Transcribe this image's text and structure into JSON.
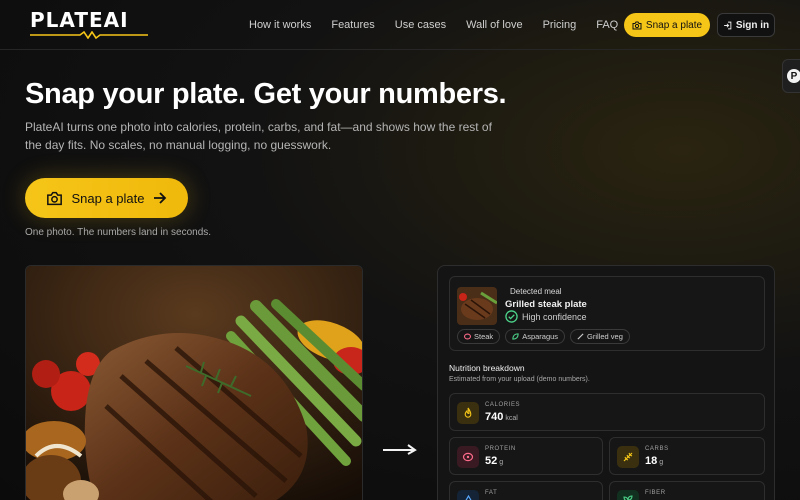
{
  "brand": {
    "name": "PLATEAI",
    "accent": "#f5c518"
  },
  "nav": {
    "links": [
      "How it works",
      "Features",
      "Use cases",
      "Wall of love",
      "Pricing",
      "FAQ"
    ],
    "cta_label": "Snap a plate",
    "signin_label": "Sign in"
  },
  "side_tab": {
    "letter": "P"
  },
  "hero": {
    "title": "Snap your plate. Get your numbers.",
    "subtitle": "PlateAI turns one photo into calories, protein, carbs, and fat—and shows how the rest of the day fits. No scales, no manual logging, no guesswork.",
    "cta_label": "Snap a plate",
    "note": "One photo. The numbers land in seconds."
  },
  "result": {
    "detected_label": "Detected meal",
    "meal_name": "Grilled steak plate",
    "confidence": "High confidence",
    "chips": [
      {
        "label": "Steak",
        "icon": "steak-icon"
      },
      {
        "label": "Asparagus",
        "icon": "leaf-icon"
      },
      {
        "label": "Grilled veg",
        "icon": "pepper-icon"
      }
    ],
    "breakdown_title": "Nutrition breakdown",
    "breakdown_sub": "Estimated from your upload (demo numbers).",
    "stats": {
      "calories": {
        "label": "CALORIES",
        "value": "740",
        "unit": "kcal",
        "icon": "flame-icon",
        "color": "#f5c518"
      },
      "protein": {
        "label": "PROTEIN",
        "value": "52",
        "unit": "g",
        "icon": "meat-icon",
        "color": "#ff6b8a"
      },
      "carbs": {
        "label": "CARBS",
        "value": "18",
        "unit": "g",
        "icon": "wheat-icon",
        "color": "#f5c518"
      },
      "fat": {
        "label": "FAT",
        "value": "",
        "unit": "",
        "icon": "droplet-icon",
        "color": "#5aa9ff"
      },
      "fiber": {
        "label": "FIBER",
        "value": "",
        "unit": "",
        "icon": "sprout-icon",
        "color": "#4cd38a"
      }
    }
  }
}
